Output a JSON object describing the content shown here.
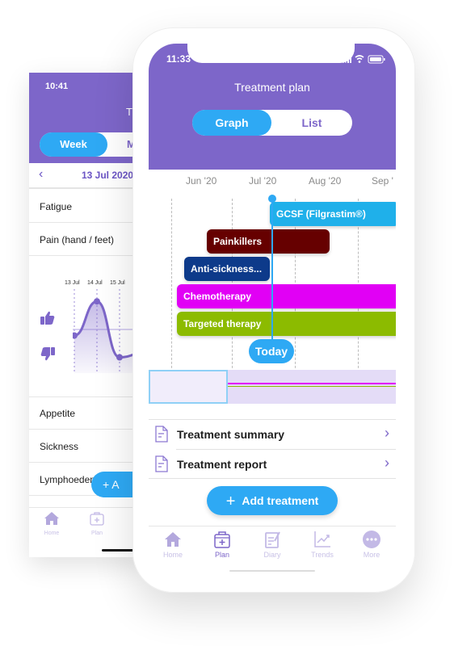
{
  "back_screen": {
    "status_time": "10:41",
    "title_partial": "T",
    "segment": {
      "active": "Week",
      "inactive_partial": "M"
    },
    "date_nav": {
      "prev_icon": "chevron-left-icon",
      "date_label": "13 Jul 2020"
    },
    "symptoms_top": [
      "Fatigue",
      "Pain (hand / feet)"
    ],
    "chart": {
      "x_ticks": [
        "13 Jul",
        "14 Jul",
        "15 Jul"
      ],
      "y_icons": [
        "thumbs-up-icon",
        "thumbs-down-icon"
      ],
      "points": [
        {
          "day": "13 Jul",
          "level": 0.45
        },
        {
          "day": "14 Jul",
          "level": 0.92
        },
        {
          "day": "15 Jul",
          "level": 0.15
        }
      ]
    },
    "symptoms_bottom": [
      "Appetite",
      "Sickness",
      "Lymphoedema"
    ],
    "fab_label": "+ A",
    "tabs": [
      {
        "label": "Home",
        "icon": "home-icon"
      },
      {
        "label": "Plan",
        "icon": "medical-kit-icon"
      }
    ]
  },
  "front_screen": {
    "status_time": "11:33",
    "title": "Treatment plan",
    "segment": {
      "graph": "Graph",
      "list": "List",
      "active": "Graph"
    },
    "months": [
      "Jun '20",
      "Jul '20",
      "Aug '20",
      "Sep '"
    ],
    "treatments": [
      {
        "name": "GCSF (Filgrastim®)",
        "color": "#1fb0ea"
      },
      {
        "name": "Painkillers",
        "color": "#660000"
      },
      {
        "name": "Anti-sickness...",
        "color": "#0d3a8a"
      },
      {
        "name": "Chemotherapy",
        "color": "#e100f5"
      },
      {
        "name": "Targeted therapy",
        "color": "#8cbb00"
      }
    ],
    "today_label": "Today",
    "links": [
      {
        "label": "Treatment summary",
        "icon": "document-icon"
      },
      {
        "label": "Treatment report",
        "icon": "document-icon"
      }
    ],
    "add_button": "Add treatment",
    "tabs": [
      {
        "label": "Home",
        "icon": "home-icon",
        "active": false
      },
      {
        "label": "Plan",
        "icon": "medical-kit-icon",
        "active": true
      },
      {
        "label": "Diary",
        "icon": "diary-icon",
        "active": false
      },
      {
        "label": "Trends",
        "icon": "trends-icon",
        "active": false
      },
      {
        "label": "More",
        "icon": "more-icon",
        "active": false
      }
    ]
  },
  "colors": {
    "brand_purple": "#7d66c9",
    "accent_blue": "#2ea9f4"
  }
}
